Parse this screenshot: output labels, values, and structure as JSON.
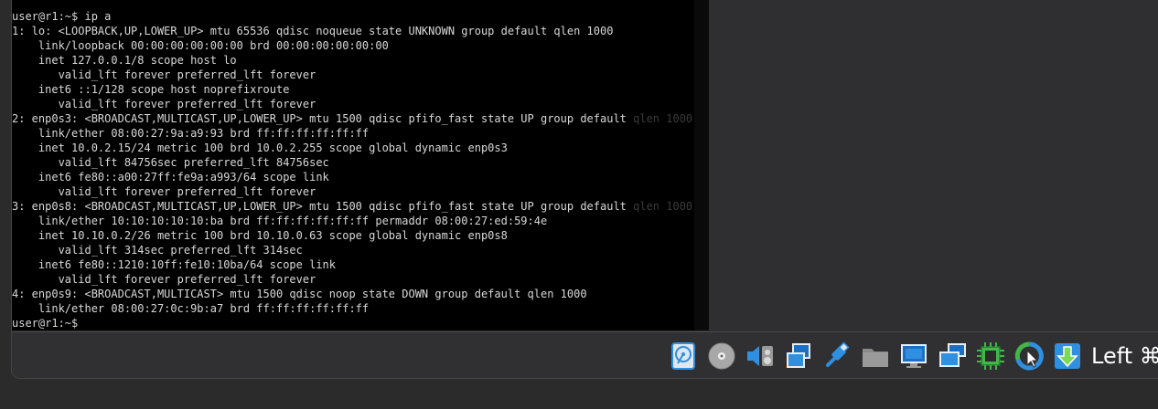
{
  "terminal": {
    "lines": [
      {
        "text": "user@r1:~$ ip a",
        "tail": ""
      },
      {
        "text": "1: lo: <LOOPBACK,UP,LOWER_UP> mtu 65536 qdisc noqueue state UNKNOWN group default qlen 1000",
        "tail": ""
      },
      {
        "text": "    link/loopback 00:00:00:00:00:00 brd 00:00:00:00:00:00",
        "tail": ""
      },
      {
        "text": "    inet 127.0.0.1/8 scope host lo",
        "tail": ""
      },
      {
        "text": "       valid_lft forever preferred_lft forever",
        "tail": ""
      },
      {
        "text": "    inet6 ::1/128 scope host noprefixroute",
        "tail": ""
      },
      {
        "text": "       valid_lft forever preferred_lft forever",
        "tail": ""
      },
      {
        "text": "2: enp0s3: <BROADCAST,MULTICAST,UP,LOWER_UP> mtu 1500 qdisc pfifo_fast state UP group default ",
        "tail": "qlen 1000"
      },
      {
        "text": "    link/ether 08:00:27:9a:a9:93 brd ff:ff:ff:ff:ff:ff",
        "tail": ""
      },
      {
        "text": "    inet 10.0.2.15/24 metric 100 brd 10.0.2.255 scope global dynamic enp0s3",
        "tail": ""
      },
      {
        "text": "       valid_lft 84756sec preferred_lft 84756sec",
        "tail": ""
      },
      {
        "text": "    inet6 fe80::a00:27ff:fe9a:a993/64 scope link",
        "tail": ""
      },
      {
        "text": "       valid_lft forever preferred_lft forever",
        "tail": ""
      },
      {
        "text": "3: enp0s8: <BROADCAST,MULTICAST,UP,LOWER_UP> mtu 1500 qdisc pfifo_fast state UP group default ",
        "tail": "qlen 1000"
      },
      {
        "text": "    link/ether 10:10:10:10:10:ba brd ff:ff:ff:ff:ff:ff permaddr 08:00:27:ed:59:4e",
        "tail": ""
      },
      {
        "text": "    inet 10.10.0.2/26 metric 100 brd 10.10.0.63 scope global dynamic enp0s8",
        "tail": ""
      },
      {
        "text": "       valid_lft 314sec preferred_lft 314sec",
        "tail": ""
      },
      {
        "text": "    inet6 fe80::1210:10ff:fe10:10ba/64 scope link",
        "tail": ""
      },
      {
        "text": "       valid_lft forever preferred_lft forever",
        "tail": ""
      },
      {
        "text": "4: enp0s9: <BROADCAST,MULTICAST> mtu 1500 qdisc noop state DOWN group default qlen 1000",
        "tail": ""
      },
      {
        "text": "    link/ether 08:00:27:0c:9b:a7 brd ff:ff:ff:ff:ff:ff",
        "tail": ""
      },
      {
        "text": "user@r1:~$ ",
        "tail": ""
      }
    ]
  },
  "statusbar": {
    "icons": [
      {
        "name": "hard-disk-icon"
      },
      {
        "name": "optical-drive-icon"
      },
      {
        "name": "audio-icon"
      },
      {
        "name": "network-icon"
      },
      {
        "name": "usb-icon"
      },
      {
        "name": "shared-folders-icon"
      },
      {
        "name": "display-icon"
      },
      {
        "name": "video-capture-icon"
      },
      {
        "name": "cpu-icon"
      },
      {
        "name": "mouse-integration-icon"
      },
      {
        "name": "keyboard-capture-icon"
      }
    ],
    "host_key_label": "Left ⌘"
  },
  "colors": {
    "terminal_bg": "#000000",
    "terminal_fg": "#d8d8d8",
    "terminal_dim": "#3a3a3a",
    "icon_blue": "#2f8fe0",
    "icon_green": "#42b649",
    "icon_gray": "#9a9a9a"
  }
}
